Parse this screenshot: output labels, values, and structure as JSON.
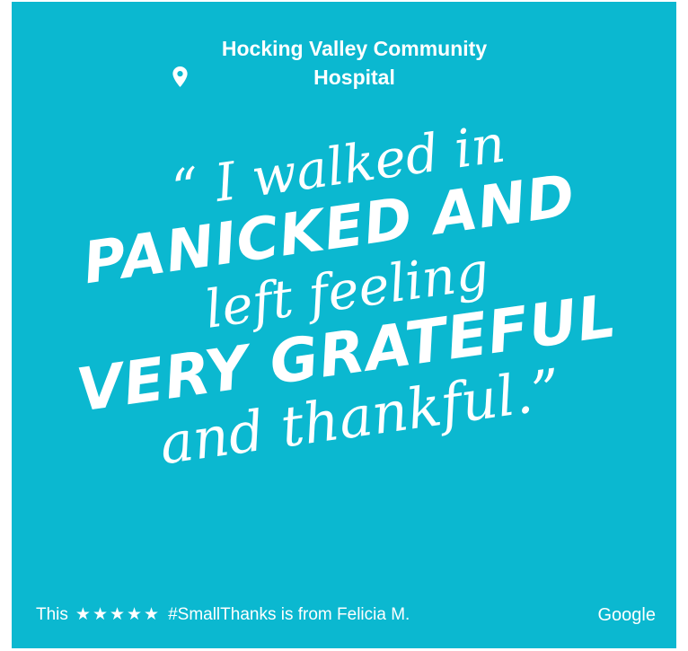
{
  "colors": {
    "background": "#0bb8d0",
    "text": "#ffffff"
  },
  "header": {
    "icon": "map-pin-icon",
    "location_name": "Hocking Valley Community Hospital"
  },
  "quote": {
    "open_mark": "“",
    "line1": "I walked in",
    "line2": "PANICKED AND",
    "line3": "left feeling",
    "line4": "VERY GRATEFUL",
    "line5": "and thankful.",
    "close_mark": "”"
  },
  "footer": {
    "prefix": "This",
    "stars": "★★★★★",
    "rating": 5,
    "suffix": "#SmallThanks is from Felicia M.",
    "brand": "Google"
  }
}
